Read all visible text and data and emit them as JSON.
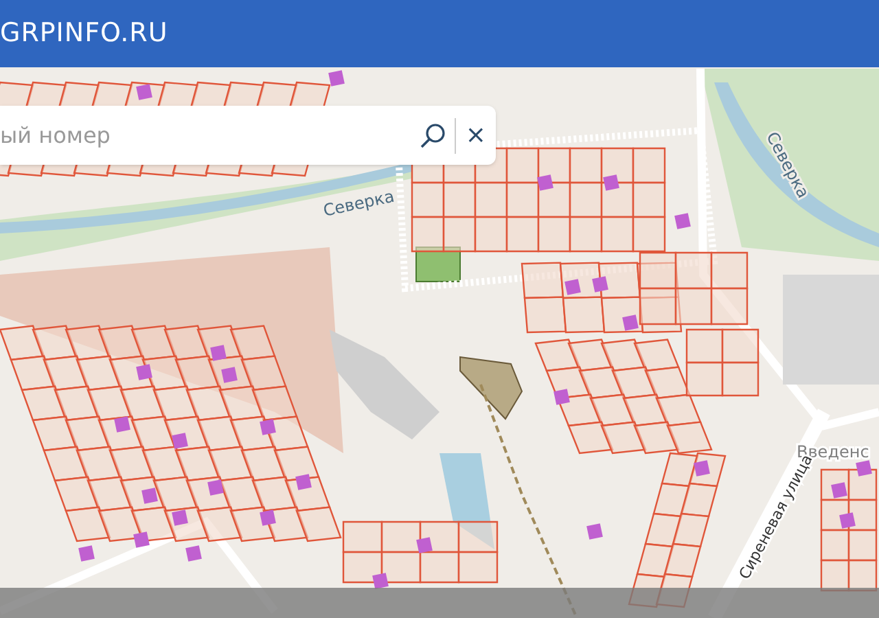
{
  "header": {
    "site_name": "GRPINFO.RU"
  },
  "search": {
    "placeholder": "ый номер",
    "clear": "×"
  },
  "map_labels": [
    {
      "text": "Северка",
      "kind": "river"
    },
    {
      "text": "Северка",
      "kind": "river"
    },
    {
      "text": "Введенс",
      "kind": "street"
    },
    {
      "text": "Сиреневая улица",
      "kind": "street"
    }
  ]
}
